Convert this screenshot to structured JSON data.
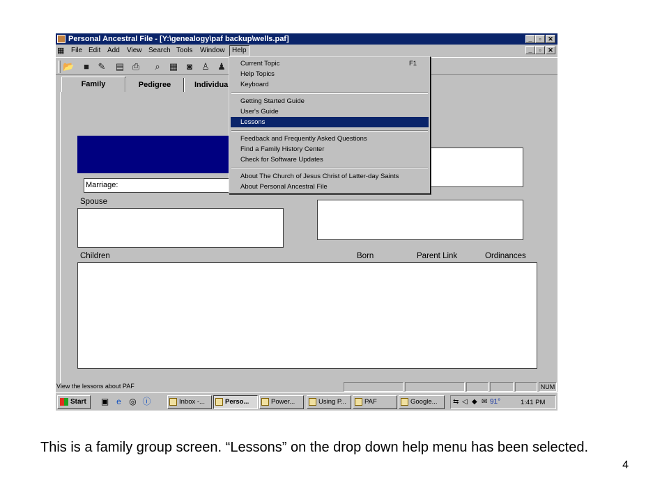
{
  "window": {
    "title": "Personal Ancestral File - [Y:\\genealogy\\paf backup\\wells.paf]",
    "controls": [
      "_",
      "▫",
      "✕"
    ]
  },
  "menubar": {
    "items": [
      "File",
      "Edit",
      "Add",
      "View",
      "Search",
      "Tools",
      "Window",
      "Help"
    ],
    "open_item": "Help"
  },
  "toolbar": {
    "icons": [
      "open-folder-icon",
      "save-icon",
      "edit-icon",
      "print-setup-icon",
      "print-icon",
      "search-icon",
      "notes-icon",
      "camera-icon",
      "add-individual-icon",
      "family-icon"
    ]
  },
  "tabs": [
    "Family",
    "Pedigree",
    "Individual"
  ],
  "tabs_selected": "Family",
  "family": {
    "marriage_label": "Marriage:",
    "spouse_label": "Spouse",
    "children_label": "Children",
    "columns": [
      "Born",
      "Parent Link",
      "Ordinances"
    ]
  },
  "help_menu": {
    "groups": [
      [
        {
          "label": "Current Topic",
          "shortcut": "F1"
        },
        {
          "label": "Help Topics"
        },
        {
          "label": "Keyboard"
        }
      ],
      [
        {
          "label": "Getting Started Guide"
        },
        {
          "label": "User's Guide"
        },
        {
          "label": "Lessons",
          "highlighted": true
        }
      ],
      [
        {
          "label": "Feedback and Frequently Asked Questions"
        },
        {
          "label": "Find a Family History Center"
        },
        {
          "label": "Check for Software Updates"
        }
      ],
      [
        {
          "label": "About The Church of Jesus Christ of Latter-day Saints"
        },
        {
          "label": "About Personal Ancestral File"
        }
      ]
    ]
  },
  "statusbar": {
    "message": "View the lessons about PAF",
    "num": "NUM"
  },
  "taskbar": {
    "start_label": "Start",
    "buttons": [
      {
        "label": "Inbox -...",
        "pressed": false
      },
      {
        "label": "Perso...",
        "pressed": true
      },
      {
        "label": "Power...",
        "pressed": false
      },
      {
        "label": "Using P...",
        "pressed": false
      },
      {
        "label": "PAF",
        "pressed": false
      },
      {
        "label": "Google...",
        "pressed": false
      }
    ],
    "temperature": "91°",
    "clock": "1:41 PM"
  },
  "colors": {
    "title_bar": "#0a246a",
    "selection": "#0a246a",
    "window_face": "#c0c0c0",
    "family_header": "#000080"
  },
  "slide": {
    "caption": "This is a family group screen.  “Lessons” on the drop down help menu has been selected.",
    "page_number": "4"
  }
}
